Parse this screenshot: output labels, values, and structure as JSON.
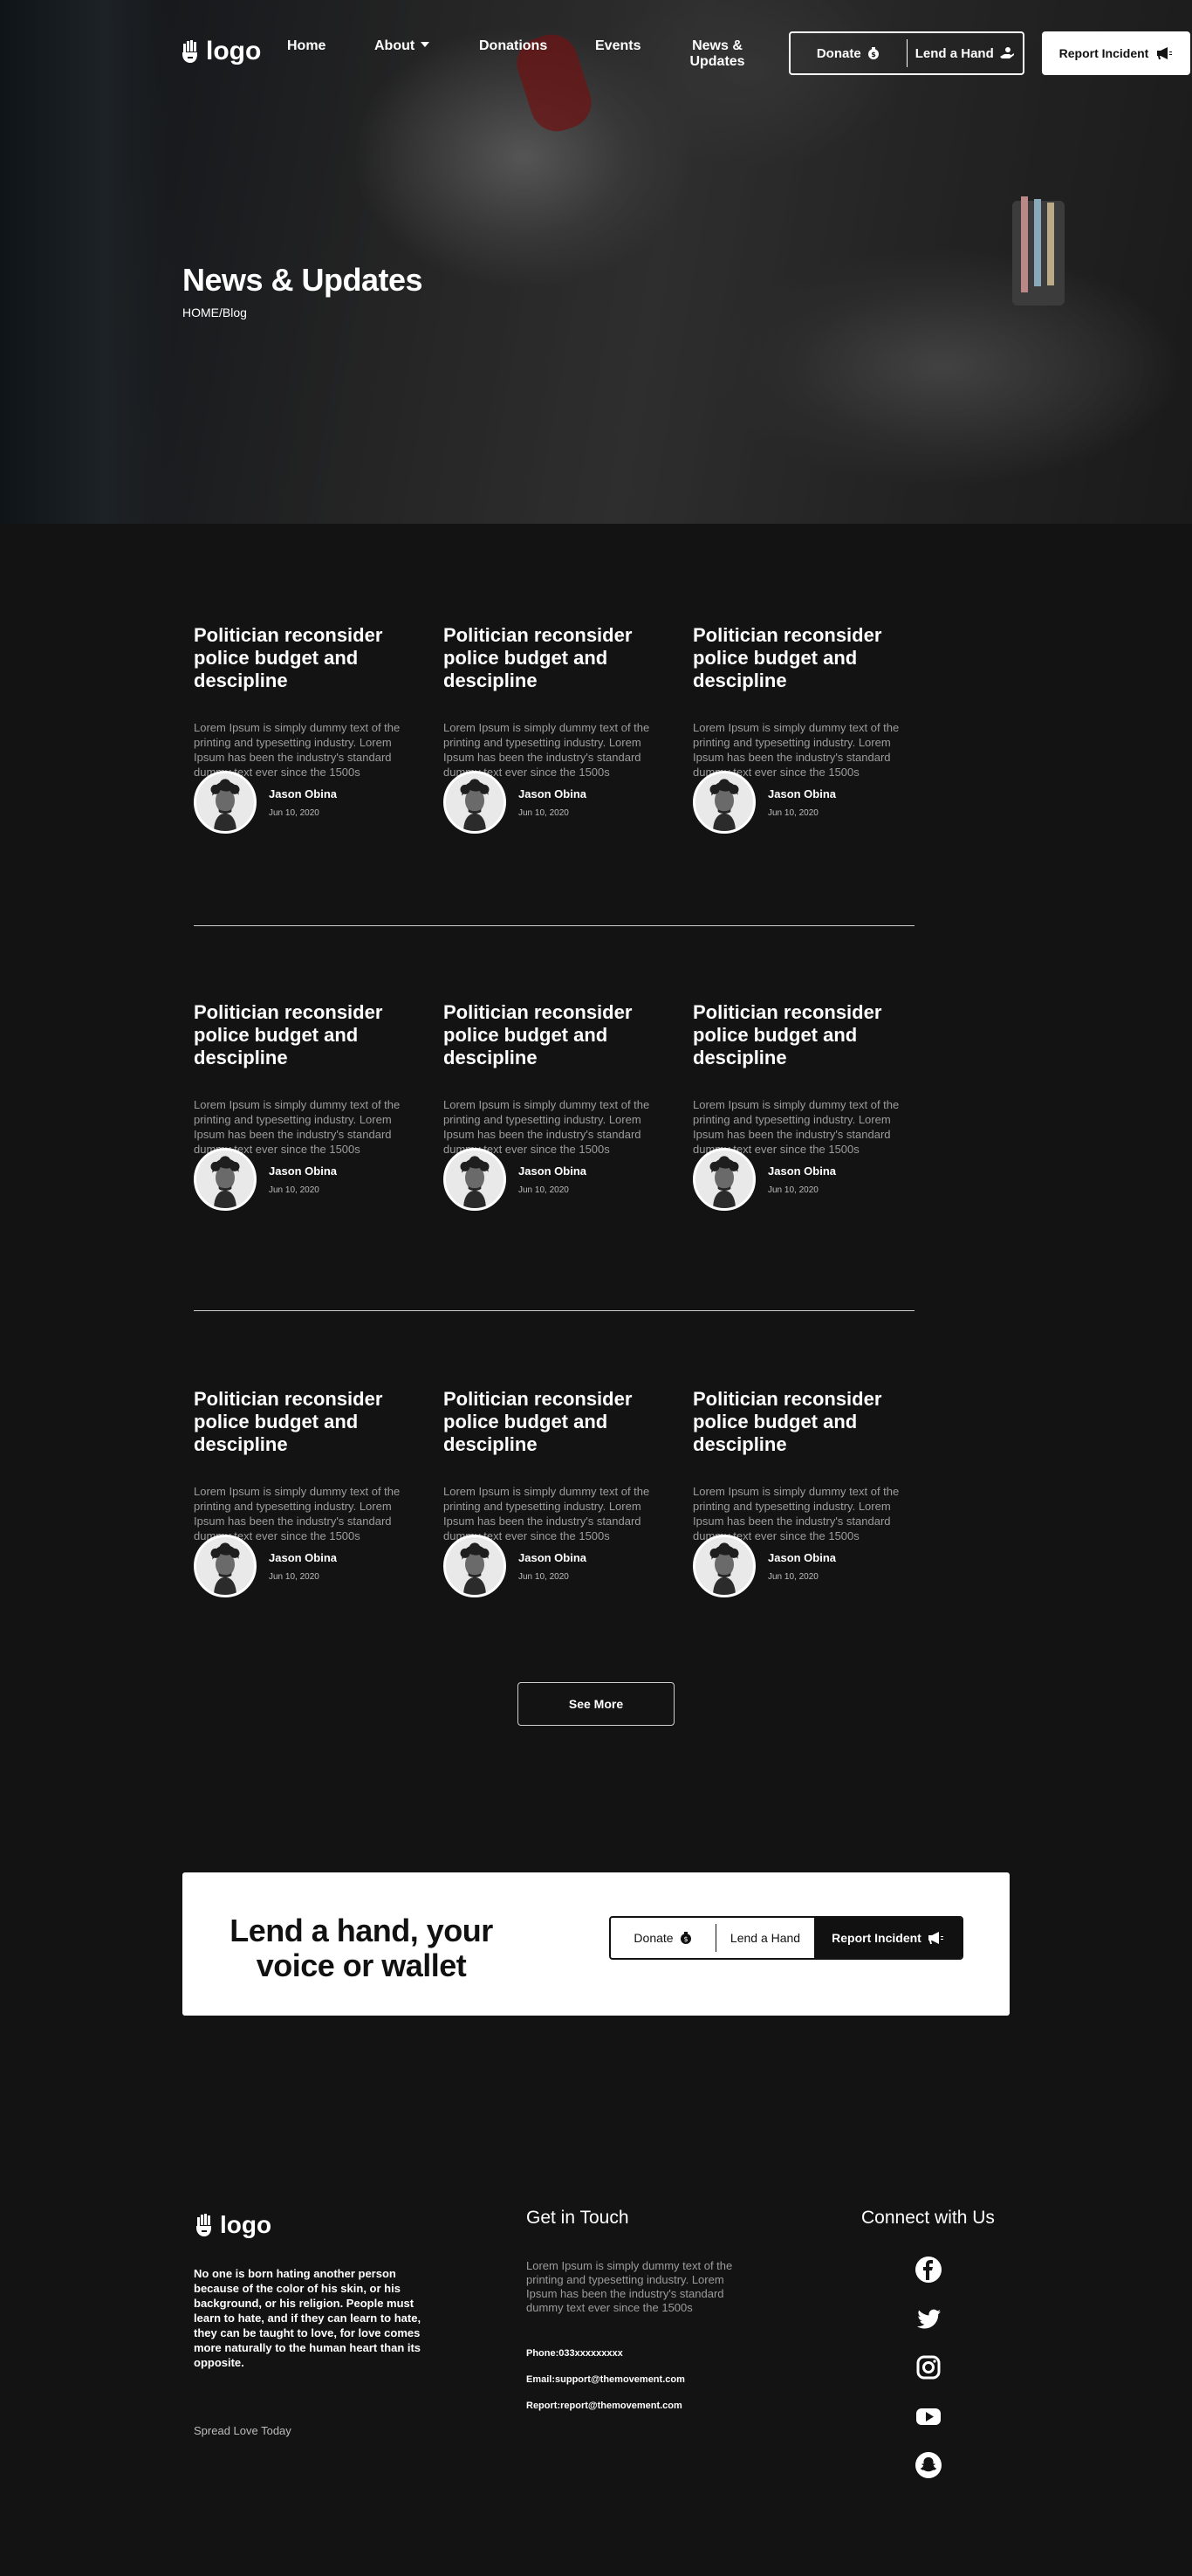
{
  "nav": {
    "logo": "logo",
    "links": [
      "Home",
      "About",
      "Donations",
      "Events",
      "News &",
      "Updates"
    ],
    "donate": "Donate",
    "lend": "Lend a Hand",
    "report": "Report Incident"
  },
  "hero": {
    "title": "News & Updates",
    "breadcrumb": "HOME/Blog"
  },
  "posts": {
    "title": "Politician reconsider police budget and descipline",
    "excerpt": "Lorem Ipsum is simply dummy text of the printing and typesetting industry. Lorem Ipsum has been the industry's standard dummy text ever since the 1500s",
    "author": "Jason Obina",
    "date": "Jun 10, 2020"
  },
  "see_more": "See More",
  "cta": {
    "title": "Lend a hand, your voice or wallet",
    "donate": "Donate",
    "lend": "Lend a Hand",
    "report": "Report Incident"
  },
  "footer": {
    "logo": "logo",
    "about": "No one is born hating another person because of the color of his skin, or his background, or his religion. People must learn to hate, and if they can learn to hate, they can be taught to love, for love comes more naturally to the human heart than its opposite.",
    "tagline": "Spread Love Today",
    "git_heading": "Get in Touch",
    "git_text": "Lorem Ipsum is simply dummy text of the printing and typesetting industry. Lorem Ipsum has been the industry's standard dummy text ever since the 1500s",
    "phone": "Phone:033xxxxxxxxx",
    "email": "Email:support@themovement.com",
    "report_email": "Report:report@themovement.com",
    "connect_heading": "Connect with Us",
    "social": [
      "facebook-icon",
      "twitter-icon",
      "instagram-icon",
      "youtube-icon",
      "snapchat-icon"
    ]
  }
}
